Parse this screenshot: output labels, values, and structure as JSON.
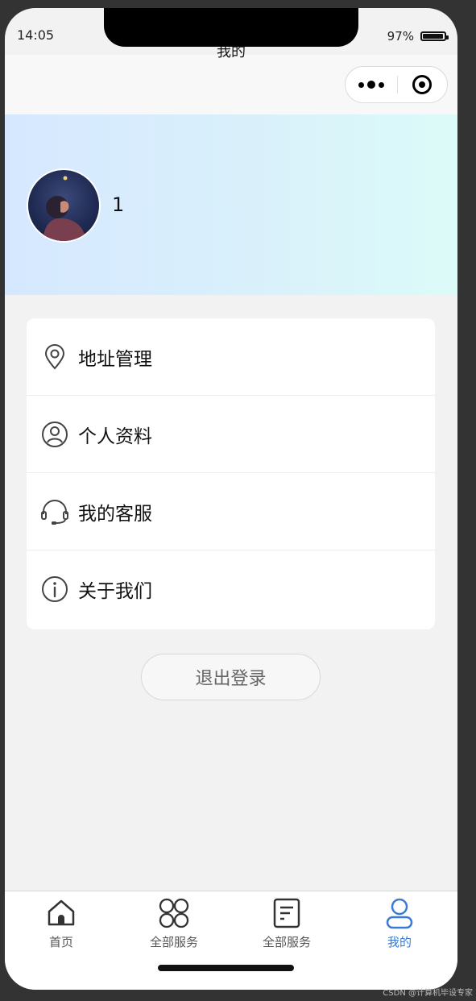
{
  "status_bar": {
    "time": "14:05",
    "battery": "97%"
  },
  "navbar": {
    "title": "我的"
  },
  "profile": {
    "username": "1"
  },
  "menu": [
    {
      "label": "地址管理",
      "icon": "location-icon"
    },
    {
      "label": "个人资料",
      "icon": "user-circle-icon"
    },
    {
      "label": "我的客服",
      "icon": "headset-icon"
    },
    {
      "label": "关于我们",
      "icon": "info-icon"
    }
  ],
  "logout_label": "退出登录",
  "tabs": [
    {
      "label": "首页",
      "icon": "home-icon",
      "active": false
    },
    {
      "label": "全部服务",
      "icon": "grid-icon",
      "active": false
    },
    {
      "label": "全部服务",
      "icon": "document-icon",
      "active": false
    },
    {
      "label": "我的",
      "icon": "person-icon",
      "active": true
    }
  ],
  "watermark": "CSDN @计算机毕设专家",
  "colors": {
    "active_tab": "#3a7bd5",
    "header_gradient_start": "#d6e8ff",
    "header_gradient_end": "#dbfbf8"
  }
}
